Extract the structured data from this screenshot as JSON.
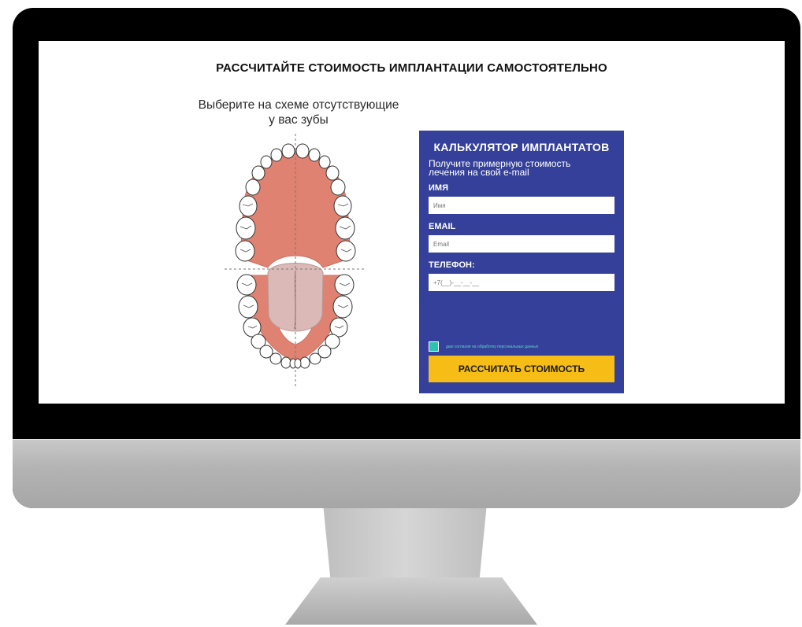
{
  "page": {
    "title": "РАССЧИТАЙТЕ СТОИМОСТЬ ИМПЛАНТАЦИИ САМОСТОЯТЕЛЬНО",
    "teeth_caption": "Выберите на схеме отсутствующие у вас зубы"
  },
  "calculator": {
    "title": "КАЛЬКУЛЯТОР ИМПЛАНТАТОВ",
    "subtitle": "Получите примерную стоимость лечения на свой e-mail",
    "fields": [
      {
        "label": "ИМЯ",
        "placeholder": "Имя"
      },
      {
        "label": "EMAIL",
        "placeholder": "Email"
      },
      {
        "label": "ТЕЛЕФОН:",
        "placeholder": "+7(__)-__-__-__"
      }
    ],
    "consent_text": "даю согласие на обработку персональных данных",
    "consent_checked": true,
    "submit_label": "РАССЧИТАТЬ СТОИМОСТЬ"
  },
  "colors": {
    "panel": "#34409a",
    "button": "#f6bd16",
    "gum": "#e08272",
    "tongue": "#dbb9b7",
    "checkbox": "#2ec2b0"
  }
}
